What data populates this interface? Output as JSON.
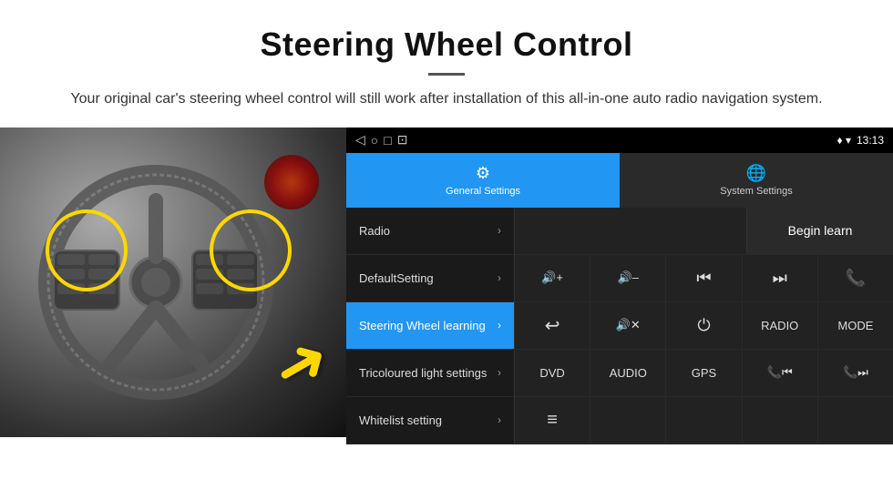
{
  "header": {
    "title": "Steering Wheel Control",
    "subtitle": "Your original car's steering wheel control will still work after installation of this all-in-one auto radio navigation system."
  },
  "status_bar": {
    "nav_icons": [
      "◁",
      "○",
      "□",
      "⊡"
    ],
    "right_icons": "♦ ▾",
    "time": "13:13"
  },
  "tabs": [
    {
      "id": "general",
      "label": "General Settings",
      "icon": "⚙",
      "active": true
    },
    {
      "id": "system",
      "label": "System Settings",
      "icon": "🌐",
      "active": false
    }
  ],
  "menu": {
    "items": [
      {
        "label": "Radio",
        "active": false
      },
      {
        "label": "DefaultSetting",
        "active": false
      },
      {
        "label": "Steering Wheel learning",
        "active": true
      },
      {
        "label": "Tricoloured light settings",
        "active": false
      },
      {
        "label": "Whitelist setting",
        "active": false
      }
    ]
  },
  "controls": {
    "begin_learn_label": "Begin learn",
    "input_placeholder": "",
    "rows": [
      [
        {
          "label": "🔊+",
          "type": "icon"
        },
        {
          "label": "🔊–",
          "type": "icon"
        },
        {
          "label": "⏮",
          "type": "icon"
        },
        {
          "label": "⏭",
          "type": "icon"
        },
        {
          "label": "📞",
          "type": "icon"
        }
      ],
      [
        {
          "label": "↩",
          "type": "icon"
        },
        {
          "label": "🔊×",
          "type": "icon"
        },
        {
          "label": "⏻",
          "type": "icon"
        },
        {
          "label": "RADIO",
          "type": "text"
        },
        {
          "label": "MODE",
          "type": "text"
        }
      ],
      [
        {
          "label": "DVD",
          "type": "text"
        },
        {
          "label": "AUDIO",
          "type": "text"
        },
        {
          "label": "GPS",
          "type": "text"
        },
        {
          "label": "📞⏮",
          "type": "icon"
        },
        {
          "label": "📞⏭",
          "type": "icon"
        }
      ],
      [
        {
          "label": "≡",
          "type": "icon"
        },
        {
          "label": "",
          "type": "empty"
        },
        {
          "label": "",
          "type": "empty"
        },
        {
          "label": "",
          "type": "empty"
        },
        {
          "label": "",
          "type": "empty"
        }
      ]
    ]
  }
}
